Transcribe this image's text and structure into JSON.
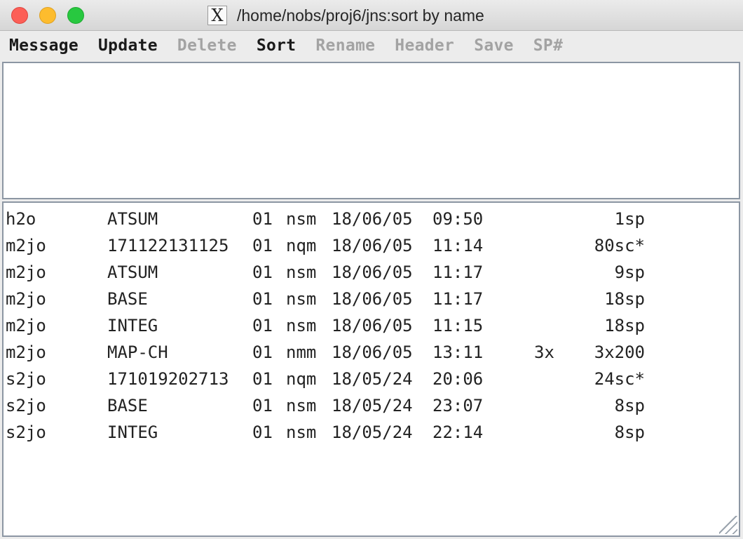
{
  "window": {
    "title": "/home/nobs/proj6/jns:sort by name",
    "app_icon": "X"
  },
  "menu": [
    {
      "label": "Message",
      "enabled": true
    },
    {
      "label": "Update",
      "enabled": true
    },
    {
      "label": "Delete",
      "enabled": false
    },
    {
      "label": "Sort",
      "enabled": true
    },
    {
      "label": "Rename",
      "enabled": false
    },
    {
      "label": "Header",
      "enabled": false
    },
    {
      "label": "Save",
      "enabled": false
    },
    {
      "label": "SP#",
      "enabled": false
    }
  ],
  "files": [
    {
      "name": "h2o",
      "id": "ATSUM",
      "ver": "01",
      "type": "nsm",
      "date": "18/06/05",
      "time": "09:50",
      "ext": "",
      "size": "1sp"
    },
    {
      "name": "m2jo",
      "id": "171122131125",
      "ver": "01",
      "type": "nqm",
      "date": "18/06/05",
      "time": "11:14",
      "ext": "",
      "size": "80sc*"
    },
    {
      "name": "m2jo",
      "id": "ATSUM",
      "ver": "01",
      "type": "nsm",
      "date": "18/06/05",
      "time": "11:17",
      "ext": "",
      "size": "9sp"
    },
    {
      "name": "m2jo",
      "id": "BASE",
      "ver": "01",
      "type": "nsm",
      "date": "18/06/05",
      "time": "11:17",
      "ext": "",
      "size": "18sp"
    },
    {
      "name": "m2jo",
      "id": "INTEG",
      "ver": "01",
      "type": "nsm",
      "date": "18/06/05",
      "time": "11:15",
      "ext": "",
      "size": "18sp"
    },
    {
      "name": "m2jo",
      "id": "MAP-CH",
      "ver": "01",
      "type": "nmm",
      "date": "18/06/05",
      "time": "13:11",
      "ext": "3x",
      "size": "3x200"
    },
    {
      "name": "s2jo",
      "id": "171019202713",
      "ver": "01",
      "type": "nqm",
      "date": "18/05/24",
      "time": "20:06",
      "ext": "",
      "size": "24sc*"
    },
    {
      "name": "s2jo",
      "id": "BASE",
      "ver": "01",
      "type": "nsm",
      "date": "18/05/24",
      "time": "23:07",
      "ext": "",
      "size": "8sp"
    },
    {
      "name": "s2jo",
      "id": "INTEG",
      "ver": "01",
      "type": "nsm",
      "date": "18/05/24",
      "time": "22:14",
      "ext": "",
      "size": "8sp"
    }
  ]
}
